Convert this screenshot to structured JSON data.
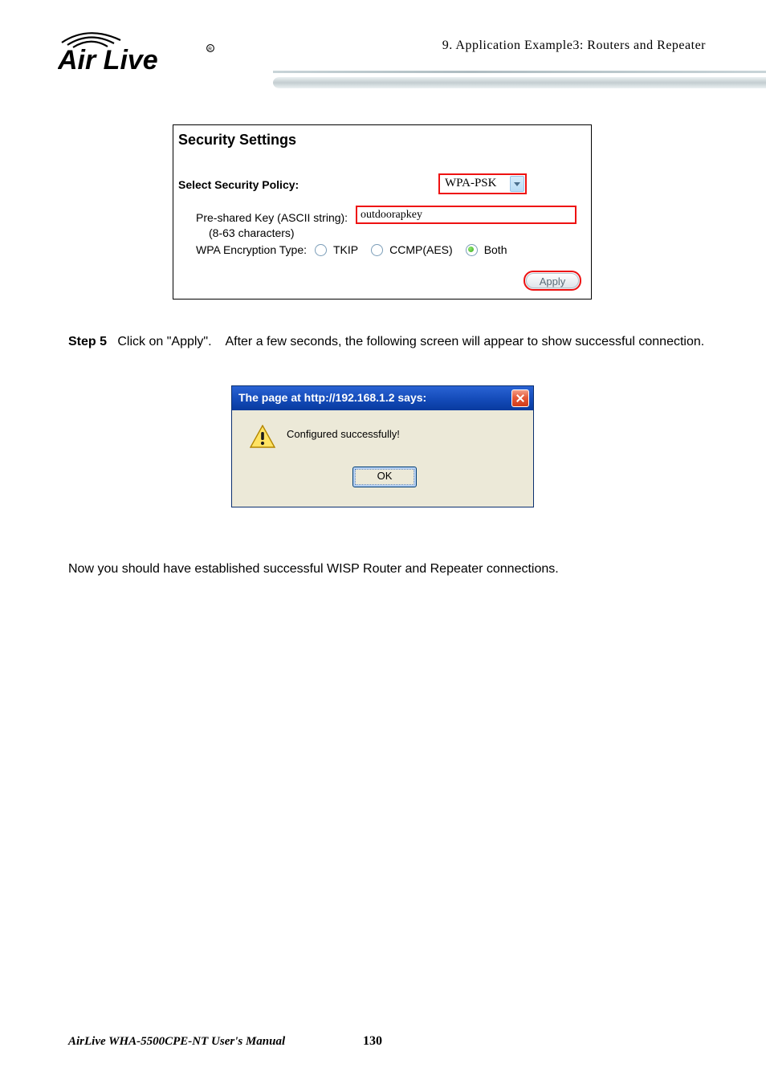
{
  "header": {
    "logo_text": "Air Live",
    "chapter": "9. Application Example3: Routers and Repeater"
  },
  "security_panel": {
    "title": "Security Settings",
    "policy_label": "Select Security Policy:",
    "policy_value": "WPA-PSK",
    "psk_label": "Pre-shared Key (ASCII string):",
    "psk_hint": "(8-63 characters)",
    "psk_value": "outdoorapkey",
    "enc_label": "WPA Encryption Type:",
    "enc_options": {
      "tkip": "TKIP",
      "ccmp": "CCMP(AES)",
      "both": "Both"
    },
    "enc_selected": "both",
    "apply_label": "Apply"
  },
  "step5": {
    "label": "Step 5",
    "text_a": "Click on \"Apply\".",
    "text_b": "After a few seconds, the following screen will appear to show successful connection."
  },
  "dialog": {
    "title": "The page at http://192.168.1.2 says:",
    "message": "Configured successfully!",
    "ok_label": "OK"
  },
  "final_text": "Now you should have established successful WISP Router and Repeater connections.",
  "footer": {
    "manual": "AirLive WHA-5500CPE-NT User's Manual",
    "page": "130"
  }
}
